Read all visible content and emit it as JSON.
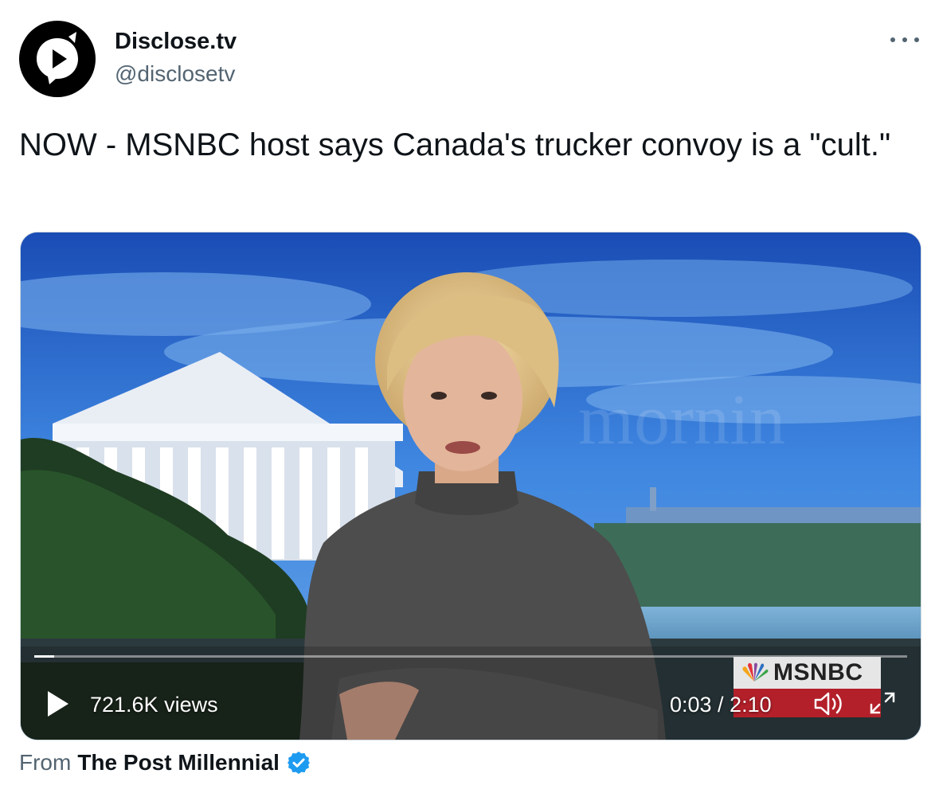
{
  "author": {
    "name": "Disclose.tv",
    "handle": "@disclosetv"
  },
  "tweet": {
    "text": "NOW - MSNBC host says Canada's trucker convoy is a \"cult.\""
  },
  "video": {
    "views": "721.6K views",
    "time": "0:03 / 2:10",
    "progress_fraction": 0.023,
    "network_bug": "MSNBC"
  },
  "source": {
    "prefix": "From",
    "name": "The Post Millennial"
  },
  "icons": {
    "more": "more-horizontal-icon",
    "play": "play-icon",
    "volume": "volume-icon",
    "fullscreen": "fullscreen-icon",
    "verified": "verified-badge-icon",
    "avatar_logo": "play-speech-bubble-logo"
  },
  "colors": {
    "text_primary": "#0f1419",
    "text_secondary": "#536471",
    "verified": "#1d9bf0",
    "msnbc_red": "#b3202a"
  }
}
